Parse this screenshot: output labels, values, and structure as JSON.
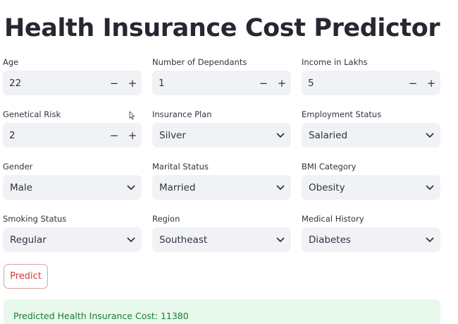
{
  "title": "Health Insurance Cost Predictor",
  "fields": {
    "age": {
      "label": "Age",
      "value": "22",
      "minus": "−",
      "plus": "+"
    },
    "dependants": {
      "label": "Number of Dependants",
      "value": "1",
      "minus": "−",
      "plus": "+"
    },
    "income": {
      "label": "Income in Lakhs",
      "value": "5",
      "minus": "−",
      "plus": "+"
    },
    "genetical_risk": {
      "label": "Genetical Risk",
      "value": "2",
      "minus": "−",
      "plus": "+"
    },
    "insurance_plan": {
      "label": "Insurance Plan",
      "value": "Silver"
    },
    "employment_status": {
      "label": "Employment Status",
      "value": "Salaried"
    },
    "gender": {
      "label": "Gender",
      "value": "Male"
    },
    "marital_status": {
      "label": "Marital Status",
      "value": "Married"
    },
    "bmi_category": {
      "label": "BMI Category",
      "value": "Obesity"
    },
    "smoking_status": {
      "label": "Smoking Status",
      "value": "Regular"
    },
    "region": {
      "label": "Region",
      "value": "Southeast"
    },
    "medical_history": {
      "label": "Medical History",
      "value": "Diabetes"
    }
  },
  "predict_label": "Predict",
  "result_text": "Predicted Health Insurance Cost: 11380",
  "icons": {
    "select": "chevron-down-icon",
    "cursor": "mouse-pointer-icon"
  },
  "colors": {
    "accent": "#d53a3a",
    "input_bg": "#f0f2f6",
    "success_bg": "#e8f8ec",
    "success_text": "#1f7a35"
  }
}
